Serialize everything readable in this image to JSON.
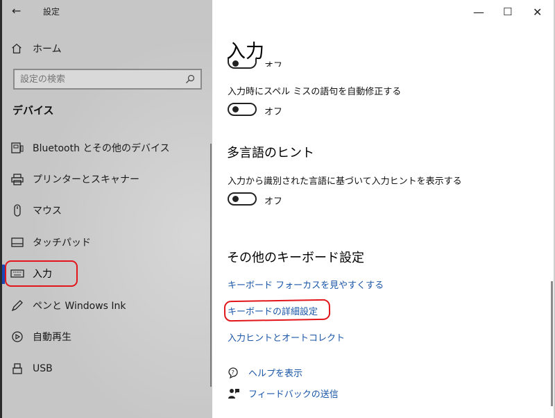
{
  "window": {
    "title": "設定",
    "minimize": "—",
    "maximize": "☐",
    "close": "✕",
    "back": "←"
  },
  "sidebar": {
    "home_label": "ホーム",
    "search_placeholder": "設定の検索",
    "section": "デバイス",
    "items": [
      {
        "label": "Bluetooth とその他のデバイス",
        "icon": "bluetooth-devices-icon"
      },
      {
        "label": "プリンターとスキャナー",
        "icon": "printer-icon"
      },
      {
        "label": "マウス",
        "icon": "mouse-icon"
      },
      {
        "label": "タッチパッド",
        "icon": "touchpad-icon"
      },
      {
        "label": "入力",
        "icon": "keyboard-icon",
        "active": true
      },
      {
        "label": "ペンと Windows Ink",
        "icon": "pen-icon"
      },
      {
        "label": "自動再生",
        "icon": "autoplay-icon"
      },
      {
        "label": "USB",
        "icon": "usb-icon"
      }
    ]
  },
  "main": {
    "title": "入力",
    "toggle_top_label": "オフ",
    "autocorrect": {
      "description": "入力時にスペル ミスの語句を自動修正する",
      "state": "オフ"
    },
    "multilang": {
      "heading": "多言語のヒント",
      "description": "入力から識別された言語に基づいて入力ヒントを表示する",
      "state": "オフ"
    },
    "other": {
      "heading": "その他のキーボード設定",
      "links": [
        "キーボード フォーカスを見やすくする",
        "キーボードの詳細設定",
        "入力ヒントとオートコレクト"
      ]
    },
    "help": {
      "show_help": "ヘルプを表示",
      "feedback": "フィードバックの送信"
    }
  },
  "colors": {
    "accent": "#1a4ab5",
    "link": "#1a56a8",
    "annotation": "#e2151b"
  }
}
